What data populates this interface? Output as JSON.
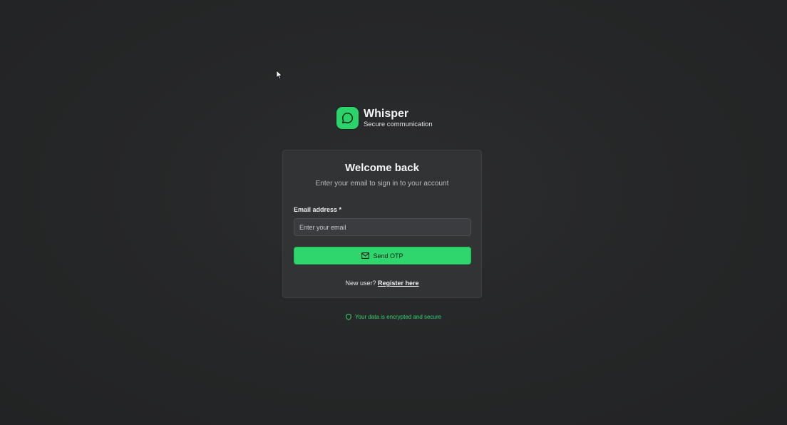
{
  "brand": {
    "name": "Whisper",
    "tagline": "Secure communication",
    "logo_icon": "chat-bubble-icon",
    "accent_color": "#2bd46a"
  },
  "login_card": {
    "title": "Welcome back",
    "subtitle": "Enter your email to sign in to your account",
    "email_label": "Email address *",
    "email_placeholder": "Enter your email",
    "email_value": "",
    "send_button_label": "Send OTP",
    "send_button_icon": "mail-icon",
    "new_user_text": "New user?",
    "register_link_label": "Register here"
  },
  "footer": {
    "secure_text": "Your data is encrypted and secure",
    "secure_icon": "shield-icon"
  }
}
